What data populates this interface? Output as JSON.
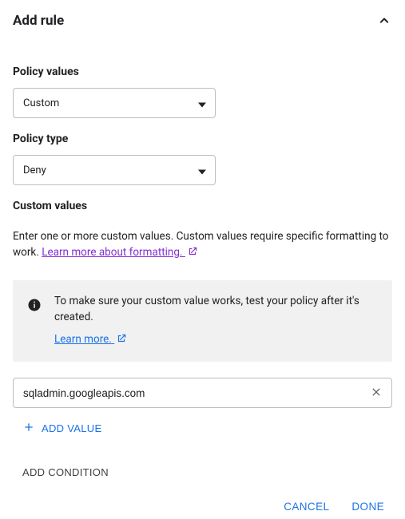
{
  "header": {
    "title": "Add rule"
  },
  "policyValues": {
    "label": "Policy values",
    "selected": "Custom"
  },
  "policyType": {
    "label": "Policy type",
    "selected": "Deny"
  },
  "customValues": {
    "label": "Custom values",
    "helpText": "Enter one or more custom values. Custom values require specific formatting to work.",
    "learnMoreLink": "Learn more about formatting.",
    "infoText": "To make sure your custom value works, test your policy after it's created.",
    "infoLearnMore": "Learn more.",
    "inputValue": "sqladmin.googleapis.com",
    "addValueLabel": "ADD VALUE"
  },
  "addConditionLabel": "ADD CONDITION",
  "footer": {
    "cancel": "CANCEL",
    "done": "DONE"
  }
}
